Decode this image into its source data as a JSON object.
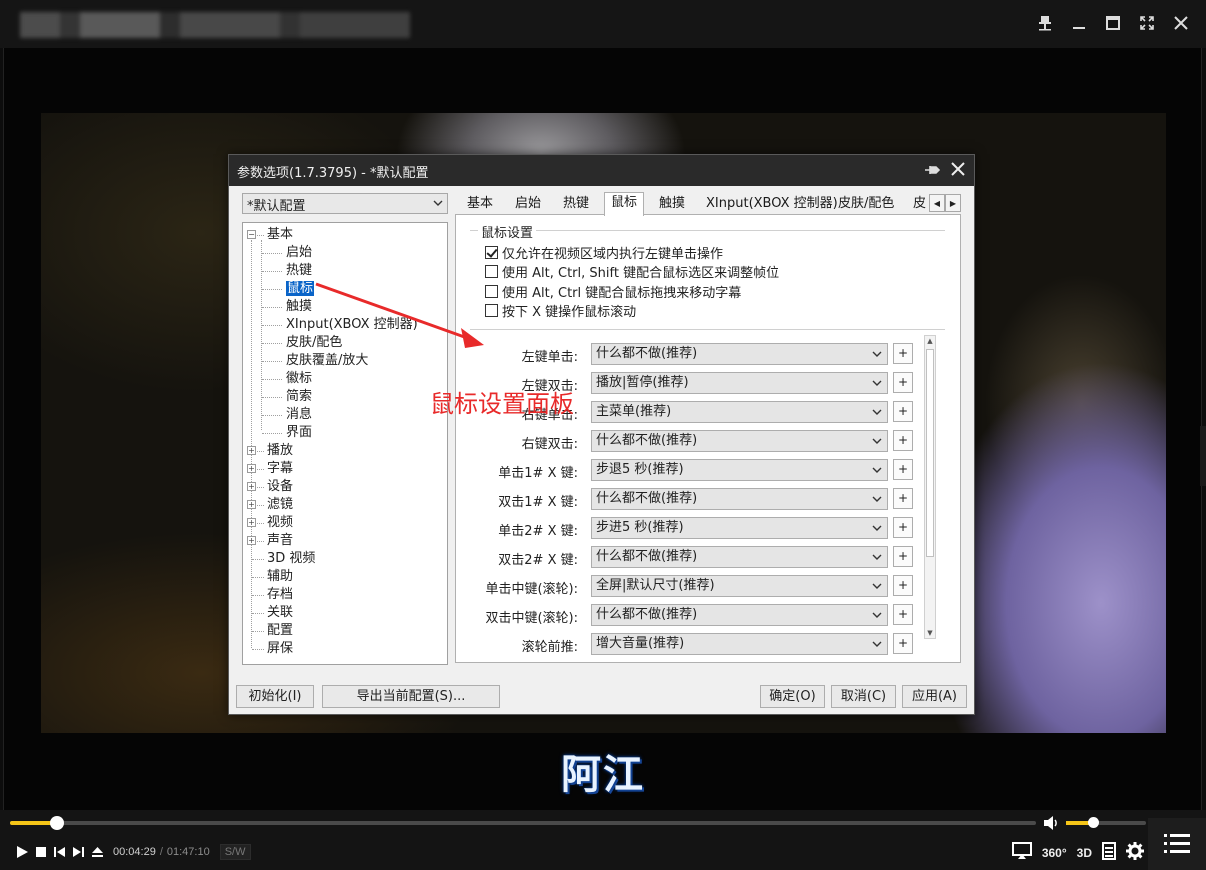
{
  "window": {
    "controls": [
      "pin-icon",
      "minimize-icon",
      "maximize-icon",
      "fullscreen-icon",
      "close-icon"
    ]
  },
  "video": {
    "subtitle": "阿江"
  },
  "player": {
    "progress_fraction": 0.046,
    "volume_fraction": 0.34,
    "time_current": "00:04:29",
    "time_sep": "/",
    "time_total": "01:47:10",
    "sw_badge": "S/W",
    "btn_360": "360°",
    "btn_3d": "3D",
    "accent_color": "#f5c518"
  },
  "dialog": {
    "title": "参数选项(1.7.3795) - *默认配置",
    "profile": "*默认配置",
    "tree": [
      {
        "label": "基本",
        "level": 0,
        "expander": "-",
        "selected": false
      },
      {
        "label": "启始",
        "level": 1,
        "selected": false
      },
      {
        "label": "热键",
        "level": 1,
        "selected": false
      },
      {
        "label": "鼠标",
        "level": 1,
        "selected": true
      },
      {
        "label": "触摸",
        "level": 1,
        "selected": false
      },
      {
        "label": "XInput(XBOX 控制器)",
        "level": 1,
        "selected": false
      },
      {
        "label": "皮肤/配色",
        "level": 1,
        "selected": false
      },
      {
        "label": "皮肤覆盖/放大",
        "level": 1,
        "selected": false
      },
      {
        "label": "徽标",
        "level": 1,
        "selected": false
      },
      {
        "label": "简索",
        "level": 1,
        "selected": false
      },
      {
        "label": "消息",
        "level": 1,
        "selected": false
      },
      {
        "label": "界面",
        "level": 1,
        "selected": false
      },
      {
        "label": "播放",
        "level": 0,
        "expander": "+",
        "selected": false
      },
      {
        "label": "字幕",
        "level": 0,
        "expander": "+",
        "selected": false
      },
      {
        "label": "设备",
        "level": 0,
        "expander": "+",
        "selected": false
      },
      {
        "label": "滤镜",
        "level": 0,
        "expander": "+",
        "selected": false
      },
      {
        "label": "视频",
        "level": 0,
        "expander": "+",
        "selected": false
      },
      {
        "label": "声音",
        "level": 0,
        "expander": "+",
        "selected": false
      },
      {
        "label": "3D 视频",
        "level": 0,
        "selected": false
      },
      {
        "label": "辅助",
        "level": 0,
        "selected": false
      },
      {
        "label": "存档",
        "level": 0,
        "selected": false
      },
      {
        "label": "关联",
        "level": 0,
        "selected": false
      },
      {
        "label": "配置",
        "level": 0,
        "selected": false
      },
      {
        "label": "屏保",
        "level": 0,
        "selected": false
      }
    ],
    "tabs": [
      {
        "label": "基本",
        "active": false
      },
      {
        "label": "启始",
        "active": false
      },
      {
        "label": "热键",
        "active": false
      },
      {
        "label": "鼠标",
        "active": true
      },
      {
        "label": "触摸",
        "active": false
      },
      {
        "label": "XInput(XBOX 控制器)",
        "active": false
      },
      {
        "label": "皮肤/配色",
        "active": false
      },
      {
        "label": "皮",
        "active": false
      }
    ],
    "mouse_group_title": "鼠标设置",
    "checkboxes": [
      {
        "label": "仅允许在视频区域内执行左键单击操作",
        "checked": true
      },
      {
        "label": "使用 Alt, Ctrl, Shift 键配合鼠标选区来调整帧位",
        "checked": false
      },
      {
        "label": "使用 Alt, Ctrl 键配合鼠标拖拽来移动字幕",
        "checked": false
      },
      {
        "label": "按下 X 键操作鼠标滚动",
        "checked": false
      }
    ],
    "mappings": [
      {
        "label": "左键单击:",
        "value": "什么都不做(推荐)"
      },
      {
        "label": "左键双击:",
        "value": "播放|暂停(推荐)"
      },
      {
        "label": "右键单击:",
        "value": "主菜单(推荐)"
      },
      {
        "label": "右键双击:",
        "value": "什么都不做(推荐)"
      },
      {
        "label": "单击1# X 键:",
        "value": "步退5 秒(推荐)"
      },
      {
        "label": "双击1# X 键:",
        "value": "什么都不做(推荐)"
      },
      {
        "label": "单击2# X 键:",
        "value": "步进5 秒(推荐)"
      },
      {
        "label": "双击2# X 键:",
        "value": "什么都不做(推荐)"
      },
      {
        "label": "单击中键(滚轮):",
        "value": "全屏|默认尺寸(推荐)"
      },
      {
        "label": "双击中键(滚轮):",
        "value": "什么都不做(推荐)"
      },
      {
        "label": "滚轮前推:",
        "value": "增大音量(推荐)"
      }
    ],
    "plus_label": "+",
    "buttons": {
      "reset": "初始化(I)",
      "export": "导出当前配置(S)...",
      "ok": "确定(O)",
      "cancel": "取消(C)",
      "apply": "应用(A)"
    }
  },
  "annotation": {
    "text": "鼠标设置面板",
    "color": "#e82a2a"
  }
}
